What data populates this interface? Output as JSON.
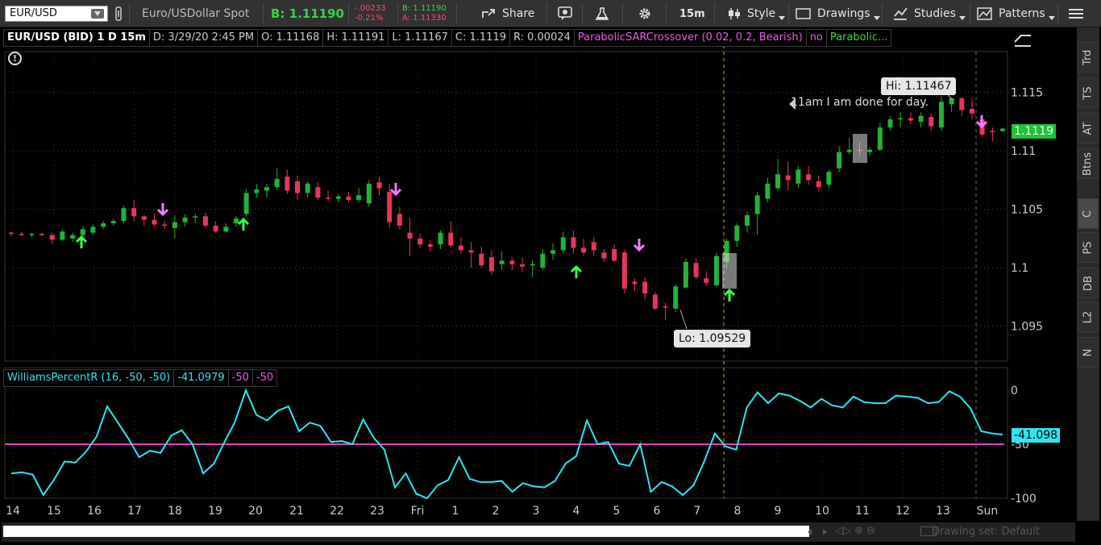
{
  "toolbar": {
    "symbol": "EUR/USD",
    "description": "Euro/USDollar Spot",
    "bid": "B: 1.11190",
    "change": "-.00233",
    "change_pct": "-0.21%",
    "bid_small": "B: 1.11190",
    "ask_small": "A: 1.11330",
    "share": "Share",
    "timeframe": "15m",
    "style": "Style",
    "drawings": "Drawings",
    "studies": "Studies",
    "patterns": "Patterns"
  },
  "info_bar": {
    "title": "EUR/USD (BID) 1 D 15m",
    "date": "D: 3/29/20 2:45 PM",
    "open": "O: 1.11168",
    "high": "H: 1.11191",
    "low": "L: 1.11167",
    "close": "C: 1.1119",
    "range": "R: 0.00024",
    "study": "ParabolicSARCrossover (0.02, 0.2, Bearish)",
    "study_no": "no",
    "study2": "Parabolic..."
  },
  "annotations": {
    "hi": "Hi: 1.11467",
    "lo": "Lo: 1.09529",
    "note": "11am I am done for day.",
    "last_price": "1.1119",
    "wpr_last": "-41.098"
  },
  "wpr_header": {
    "name": "WilliamsPercentR (16, -50, -50)",
    "value": "-41.0979",
    "p1": "-50",
    "p2": "-50"
  },
  "side_tabs": [
    "Trd",
    "TS",
    "AT",
    "Btns",
    "C",
    "PS",
    "DB",
    "L2",
    "N"
  ],
  "scroll": {
    "drawing_set": "Drawing set: Default"
  },
  "colors": {
    "up": "#22b33a",
    "down": "#e8365a",
    "wpr": "#2ee5f0",
    "line50": "#e040c8",
    "arrow_up": "#37ff4a",
    "arrow_down": "#f27cff"
  },
  "chart_data": [
    {
      "type": "candlestick",
      "price_ticks": [
        1.095,
        1.1,
        1.105,
        1.11,
        1.115
      ],
      "x_ticks": [
        "14",
        "15",
        "16",
        "17",
        "18",
        "19",
        "20",
        "21",
        "22",
        "23",
        "Fri",
        "1",
        "2",
        "3",
        "4",
        "5",
        "6",
        "7",
        "8",
        "9",
        "10",
        "11",
        "12",
        "13",
        "Sun"
      ],
      "ohlc": [
        [
          1.103,
          1.1031,
          1.1027,
          1.1029
        ],
        [
          1.1029,
          1.1031,
          1.1027,
          1.1028
        ],
        [
          1.1028,
          1.103,
          1.1026,
          1.1029
        ],
        [
          1.1029,
          1.103,
          1.1027,
          1.1028
        ],
        [
          1.1028,
          1.103,
          1.102,
          1.1024
        ],
        [
          1.1024,
          1.1033,
          1.1023,
          1.1031
        ],
        [
          1.1025,
          1.103,
          1.1022,
          1.1028
        ],
        [
          1.1028,
          1.1036,
          1.1026,
          1.1033
        ],
        [
          1.103,
          1.1037,
          1.1028,
          1.1035
        ],
        [
          1.1035,
          1.104,
          1.1033,
          1.1038
        ],
        [
          1.1038,
          1.1042,
          1.1036,
          1.104
        ],
        [
          1.104,
          1.1053,
          1.1038,
          1.1051
        ],
        [
          1.1051,
          1.1058,
          1.104,
          1.1044
        ],
        [
          1.1044,
          1.1045,
          1.1036,
          1.1041
        ],
        [
          1.1041,
          1.1046,
          1.1035,
          1.1037
        ],
        [
          1.1037,
          1.104,
          1.1033,
          1.1036
        ],
        [
          1.1034,
          1.1045,
          1.1025,
          1.1039
        ],
        [
          1.1039,
          1.1046,
          1.1035,
          1.1043
        ],
        [
          1.1043,
          1.1046,
          1.1038,
          1.1044
        ],
        [
          1.1044,
          1.1047,
          1.1034,
          1.1036
        ],
        [
          1.1036,
          1.104,
          1.103,
          1.1031
        ],
        [
          1.1031,
          1.1038,
          1.103,
          1.1035
        ],
        [
          1.1038,
          1.1044,
          1.1035,
          1.1042
        ],
        [
          1.1046,
          1.1067,
          1.1044,
          1.1064
        ],
        [
          1.1064,
          1.1072,
          1.106,
          1.1067
        ],
        [
          1.1066,
          1.1072,
          1.106,
          1.1069
        ],
        [
          1.1069,
          1.1085,
          1.1067,
          1.1076
        ],
        [
          1.1078,
          1.1084,
          1.1063,
          1.1066
        ],
        [
          1.1074,
          1.1079,
          1.1058,
          1.1064
        ],
        [
          1.1064,
          1.1074,
          1.106,
          1.1072
        ],
        [
          1.1069,
          1.1073,
          1.1058,
          1.106
        ],
        [
          1.106,
          1.1066,
          1.1057,
          1.1059
        ],
        [
          1.1059,
          1.1063,
          1.1056,
          1.1061
        ],
        [
          1.1061,
          1.1065,
          1.1056,
          1.1058
        ],
        [
          1.1058,
          1.1068,
          1.1056,
          1.1062
        ],
        [
          1.1055,
          1.1075,
          1.1052,
          1.1072
        ],
        [
          1.1073,
          1.1078,
          1.1062,
          1.1068
        ],
        [
          1.1065,
          1.1072,
          1.1034,
          1.1039
        ],
        [
          1.1046,
          1.1052,
          1.1033,
          1.1036
        ],
        [
          1.103,
          1.1043,
          1.101,
          1.1025
        ],
        [
          1.1025,
          1.1029,
          1.1017,
          1.102
        ],
        [
          1.102,
          1.1024,
          1.1014,
          1.1018
        ],
        [
          1.102,
          1.1032,
          1.1016,
          1.103
        ],
        [
          1.103,
          1.104,
          1.1017,
          1.1019
        ],
        [
          1.1019,
          1.1026,
          1.1012,
          1.1015
        ],
        [
          1.1015,
          1.1022,
          1.1,
          1.1013
        ],
        [
          1.1012,
          1.1018,
          1.1,
          1.1002
        ],
        [
          1.1009,
          1.1015,
          1.0994,
          1.0997
        ],
        [
          1.1003,
          1.1014,
          1.0998,
          1.1006
        ],
        [
          1.1006,
          1.1009,
          1.0998,
          1.1003
        ],
        [
          1.1003,
          1.1009,
          1.0996,
          1.1001
        ],
        [
          1.1002,
          1.1007,
          1.0992,
          1.1003
        ],
        [
          1.1,
          1.1016,
          1.0998,
          1.1012
        ],
        [
          1.1012,
          1.1021,
          1.1007,
          1.1015
        ],
        [
          1.1015,
          1.1031,
          1.1013,
          1.1026
        ],
        [
          1.1026,
          1.1032,
          1.1012,
          1.1017
        ],
        [
          1.1017,
          1.1025,
          1.101,
          1.1013
        ],
        [
          1.1022,
          1.1026,
          1.101,
          1.1015
        ],
        [
          1.1013,
          1.1016,
          1.1005,
          1.1008
        ],
        [
          1.1016,
          1.102,
          1.1005,
          1.1006
        ],
        [
          1.1013,
          1.1016,
          1.0978,
          1.0982
        ],
        [
          1.0988,
          1.0991,
          1.098,
          1.0986
        ],
        [
          1.0988,
          1.0992,
          1.0973,
          1.0978
        ],
        [
          1.0977,
          1.0979,
          1.0964,
          1.0965
        ],
        [
          1.0967,
          1.097,
          1.0955,
          1.0966
        ],
        [
          1.0965,
          1.0986,
          1.0962,
          1.0984
        ],
        [
          1.0983,
          1.1008,
          1.0982,
          1.1005
        ],
        [
          1.1004,
          1.1008,
          1.099,
          1.0992
        ],
        [
          1.0991,
          1.0997,
          1.0984,
          1.0987
        ],
        [
          1.0985,
          1.1013,
          1.0983,
          1.101
        ],
        [
          1.1005,
          1.1025,
          1.1,
          1.1023
        ],
        [
          1.1023,
          1.1038,
          1.1018,
          1.1036
        ],
        [
          1.1036,
          1.1048,
          1.103,
          1.1045
        ],
        [
          1.1046,
          1.1065,
          1.1028,
          1.1062
        ],
        [
          1.1059,
          1.1077,
          1.1056,
          1.1072
        ],
        [
          1.1068,
          1.1093,
          1.1066,
          1.108
        ],
        [
          1.1079,
          1.1091,
          1.1066,
          1.1075
        ],
        [
          1.1072,
          1.1087,
          1.1068,
          1.1084
        ],
        [
          1.108,
          1.1087,
          1.1071,
          1.1075
        ],
        [
          1.1074,
          1.1079,
          1.1066,
          1.1069
        ],
        [
          1.1071,
          1.1084,
          1.1068,
          1.1082
        ],
        [
          1.1085,
          1.1104,
          1.1082,
          1.1099
        ],
        [
          1.1099,
          1.1111,
          1.1097,
          1.1101
        ],
        [
          1.1101,
          1.1108,
          1.1096,
          1.11
        ],
        [
          1.1099,
          1.1103,
          1.1096,
          1.1101
        ],
        [
          1.1101,
          1.1124,
          1.11,
          1.112
        ],
        [
          1.112,
          1.113,
          1.1117,
          1.1127
        ],
        [
          1.1127,
          1.1133,
          1.112,
          1.1128
        ],
        [
          1.1128,
          1.1133,
          1.1123,
          1.1126
        ],
        [
          1.1125,
          1.1133,
          1.112,
          1.113
        ],
        [
          1.1129,
          1.1132,
          1.1117,
          1.1121
        ],
        [
          1.112,
          1.1147,
          1.1117,
          1.1142
        ],
        [
          1.114,
          1.1145,
          1.1133,
          1.1145
        ],
        [
          1.1145,
          1.1146,
          1.113,
          1.1135
        ],
        [
          1.1136,
          1.1145,
          1.1127,
          1.1132
        ],
        [
          1.1127,
          1.1131,
          1.1112,
          1.1114
        ],
        [
          1.1117,
          1.112,
          1.1108,
          1.1116
        ],
        [
          1.1117,
          1.112,
          1.1116,
          1.1119
        ]
      ],
      "x_positions_note": "index"
    },
    {
      "type": "line",
      "name": "WilliamsPercentR",
      "ylim": [
        -100,
        0
      ],
      "y_ticks": [
        0,
        -50,
        -100
      ],
      "values": [
        -77,
        -76,
        -78,
        -97,
        -83,
        -66,
        -67,
        -57,
        -43,
        -15,
        -30,
        -45,
        -62,
        -56,
        -58,
        -42,
        -37,
        -50,
        -77,
        -68,
        -48,
        -29,
        0,
        -23,
        -28,
        -19,
        -15,
        -38,
        -30,
        -33,
        -48,
        -47,
        -50,
        -27,
        -44,
        -55,
        -90,
        -77,
        -96,
        -100,
        -88,
        -83,
        -62,
        -82,
        -85,
        -85,
        -84,
        -94,
        -86,
        -89,
        -90,
        -84,
        -68,
        -61,
        -28,
        -50,
        -48,
        -68,
        -70,
        -50,
        -94,
        -85,
        -89,
        -97,
        -88,
        -66,
        -40,
        -52,
        -55,
        -16,
        -2,
        -12,
        -3,
        -5,
        -10,
        -16,
        -8,
        -14,
        -16,
        -6,
        -11,
        -12,
        -12,
        -5,
        -6,
        -7,
        -12,
        -11,
        -1,
        -6,
        -17,
        -38,
        -40,
        -41
      ]
    }
  ]
}
